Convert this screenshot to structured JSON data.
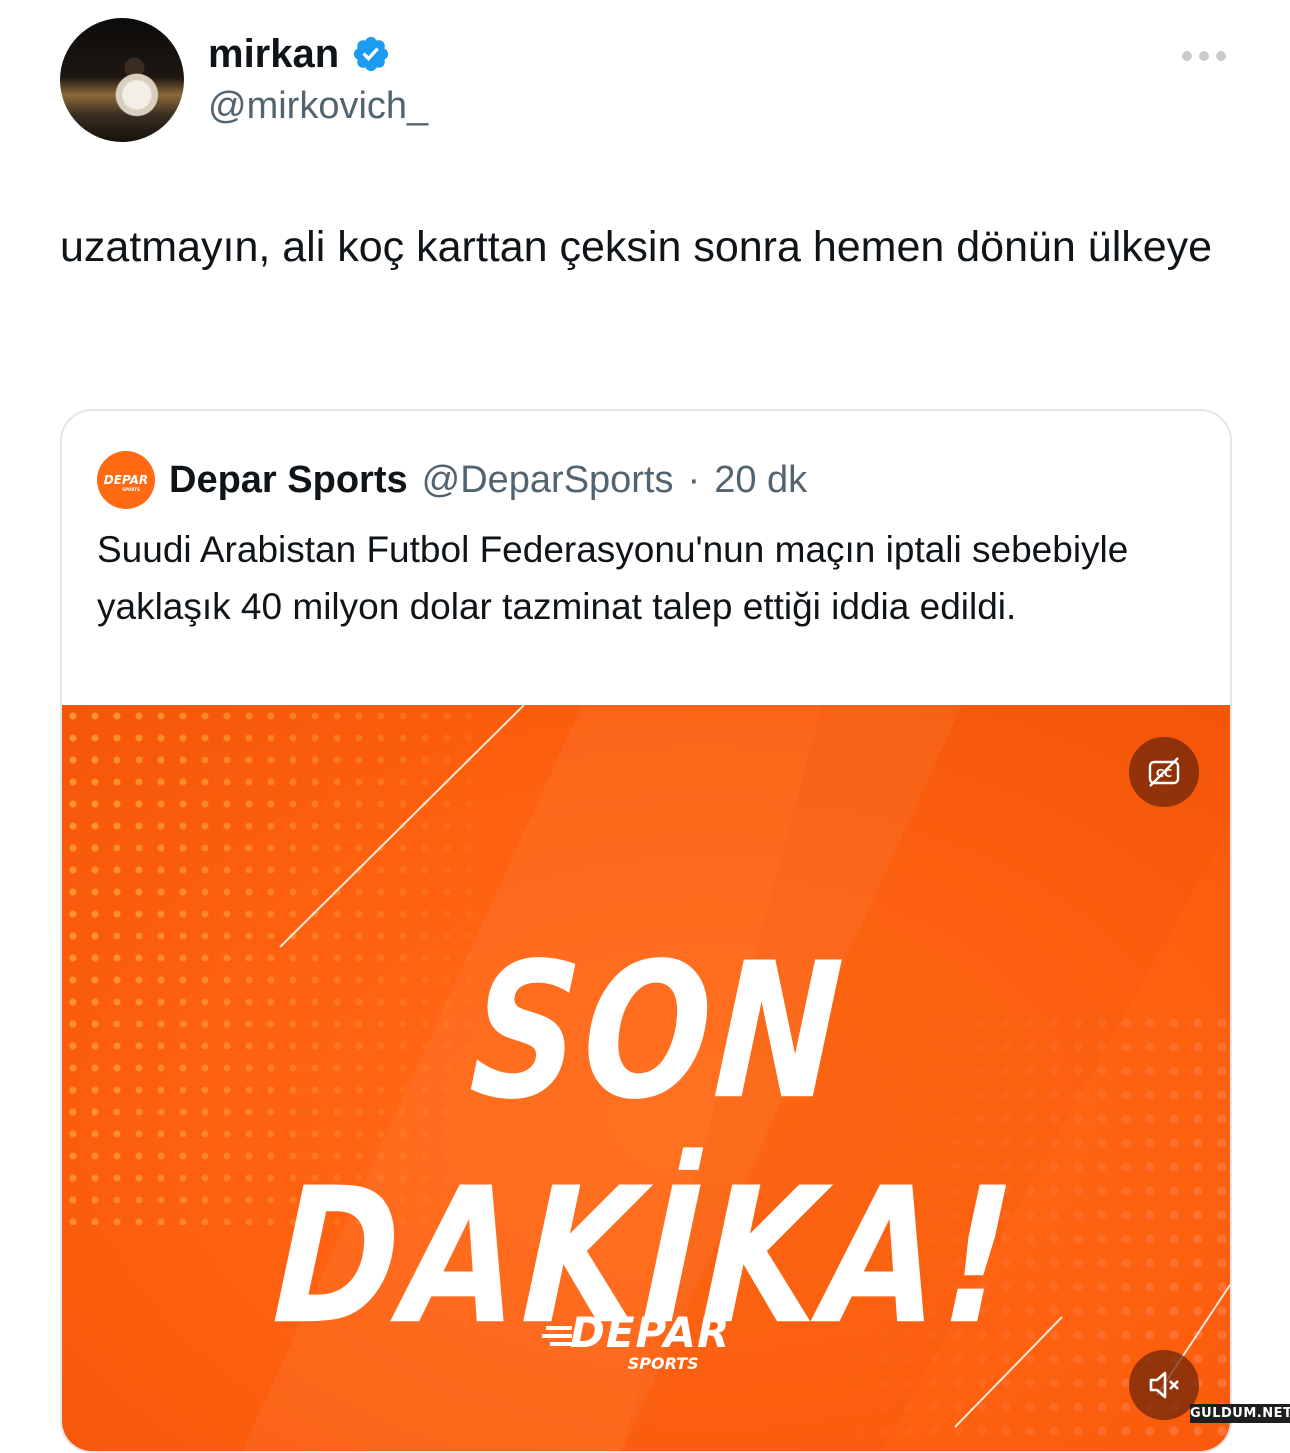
{
  "author": {
    "name": "mirkan",
    "handle": "@mirkovich_",
    "verified": true,
    "verified_color": "#1d9bf0"
  },
  "tweet": {
    "text": "uzatmayın, ali koç karttan çeksin sonra hemen dönün ülkeye"
  },
  "quoted_tweet": {
    "name": "Depar Sports",
    "handle": "@DeparSports",
    "separator": "·",
    "time": "20 dk",
    "logo_text": "DEPAR",
    "text": "Suudi Arabistan Futbol Federasyonu'nun maçın iptali sebebiyle yaklaşık 40 milyon dolar tazminat talep ettiği iddia edildi.",
    "media": {
      "headline": "SON DAKİKA!",
      "brand": "DEPAR",
      "brand_sub": "SPORTS",
      "background_color": "#ff6412",
      "captions_icon": "captions-off-icon",
      "mute_icon": "speaker-muted-icon"
    }
  },
  "watermark": "GULDUM.NET",
  "icons": {
    "more": "more-horizontal-icon",
    "verified": "verified-badge-icon"
  }
}
